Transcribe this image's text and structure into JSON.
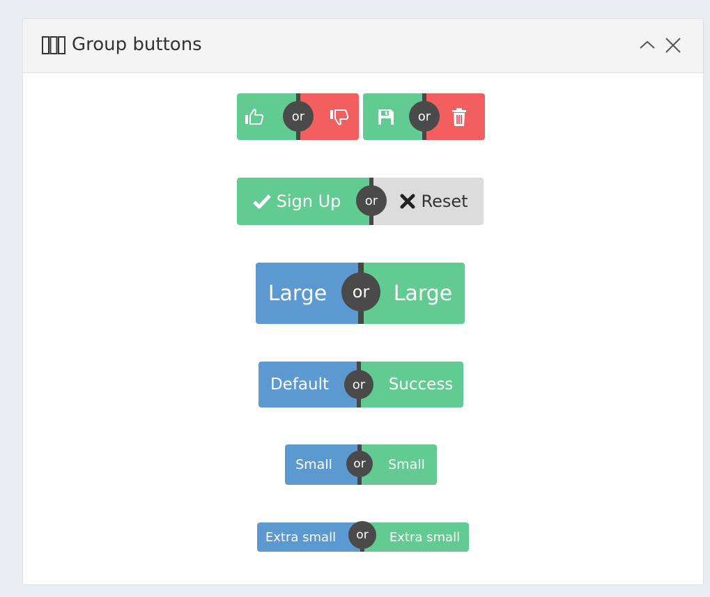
{
  "panel": {
    "title": "Group buttons",
    "icon": "columns-icon",
    "controls": {
      "collapse_icon": "chevron-up-icon",
      "close_icon": "close-icon"
    }
  },
  "separator": "or",
  "groups": {
    "thumbs": {
      "left_icon": "thumbs-up-icon",
      "right_icon": "thumbs-down-icon"
    },
    "save_delete": {
      "left_icon": "save-icon",
      "right_icon": "trash-icon"
    },
    "signup": {
      "left_label": "Sign Up",
      "left_icon": "check-icon",
      "right_label": "Reset",
      "right_icon": "times-icon"
    },
    "large": {
      "left_label": "Large",
      "right_label": "Large"
    },
    "default": {
      "left_label": "Default",
      "right_label": "Success"
    },
    "small": {
      "left_label": "Small",
      "right_label": "Small"
    },
    "xsmall": {
      "left_label": "Extra small",
      "right_label": "Extra small"
    }
  },
  "colors": {
    "success": "#62cb91",
    "danger": "#f35f5f",
    "primary": "#5d99d1",
    "default": "#dcdcdc",
    "separator": "#4a4a4a"
  }
}
